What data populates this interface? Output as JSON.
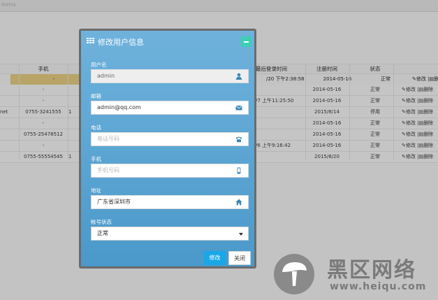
{
  "app": {
    "username_fragment": "mmo"
  },
  "table": {
    "headers": {
      "mobile": "手机",
      "last_login": "最后登录时间",
      "registered": "注册时间",
      "status": "状态"
    },
    "rows": [
      {
        "fax": "",
        "phone": "-",
        "mobile": "",
        "last_login": "/20 下午2:38:58",
        "registered": "2014-05-16",
        "status": "正常",
        "edit": "修改",
        "delete": "删除"
      },
      {
        "fax": "",
        "phone": "-",
        "mobile": "",
        "last_login": "",
        "registered": "2014-05-16",
        "status": "正常",
        "edit": "修改",
        "delete": "删除"
      },
      {
        "fax": "",
        "phone": "-",
        "mobile": "",
        "last_login": "/7 上午11:25:50",
        "registered": "2014-05-16",
        "status": "正常",
        "edit": "修改",
        "delete": "删除"
      },
      {
        "fax": "net",
        "phone": "0755-3241555",
        "mobile": "1",
        "last_login": "",
        "registered": "2015/8/14",
        "status": "停用",
        "edit": "修改",
        "delete": "删除"
      },
      {
        "fax": "",
        "phone": "-",
        "mobile": "",
        "last_login": "",
        "registered": "2014-05-16",
        "status": "正常",
        "edit": "修改",
        "delete": "删除"
      },
      {
        "fax": "",
        "phone": "0755-25478512",
        "mobile": "",
        "last_login": "",
        "registered": "2014-05-16",
        "status": "正常",
        "edit": "修改",
        "delete": "删除"
      },
      {
        "fax": "",
        "phone": "-",
        "mobile": "",
        "last_login": "/6 上午9:16:42",
        "registered": "2014-05-16",
        "status": "正常",
        "edit": "修改",
        "delete": "删除"
      },
      {
        "fax": "",
        "phone": "0755-55554545",
        "mobile": "1",
        "last_login": "",
        "registered": "2015/8/20",
        "status": "正常",
        "edit": "修改",
        "delete": "删除"
      }
    ]
  },
  "modal": {
    "title": "修改用户信息",
    "fields": {
      "username": {
        "label": "用户名",
        "value": "admin",
        "icon": "user-icon"
      },
      "email": {
        "label": "邮箱",
        "value": "admin@qq.com",
        "icon": "envelope-icon"
      },
      "phone": {
        "label": "电话",
        "placeholder": "电话号码",
        "icon": "telephone-icon"
      },
      "mobile": {
        "label": "手机",
        "placeholder": "手机号码",
        "icon": "mobile-phone-icon"
      },
      "address": {
        "label": "地址",
        "value": "广东省深圳市",
        "icon": "home-icon"
      },
      "account_status": {
        "label": "帐号状态",
        "selected": "正常"
      }
    },
    "buttons": {
      "edit": "修改",
      "close": "关闭"
    },
    "colors": {
      "header_accent": "#3ccfb4",
      "primary_button": "#1aa7e8",
      "modal_bg_top": "#6fb2dc",
      "modal_bg_bottom": "#4a99ca",
      "selected_row": "#c8b26f"
    }
  },
  "watermark": {
    "title": "黑区网络",
    "url": "www.heiqu.com"
  }
}
